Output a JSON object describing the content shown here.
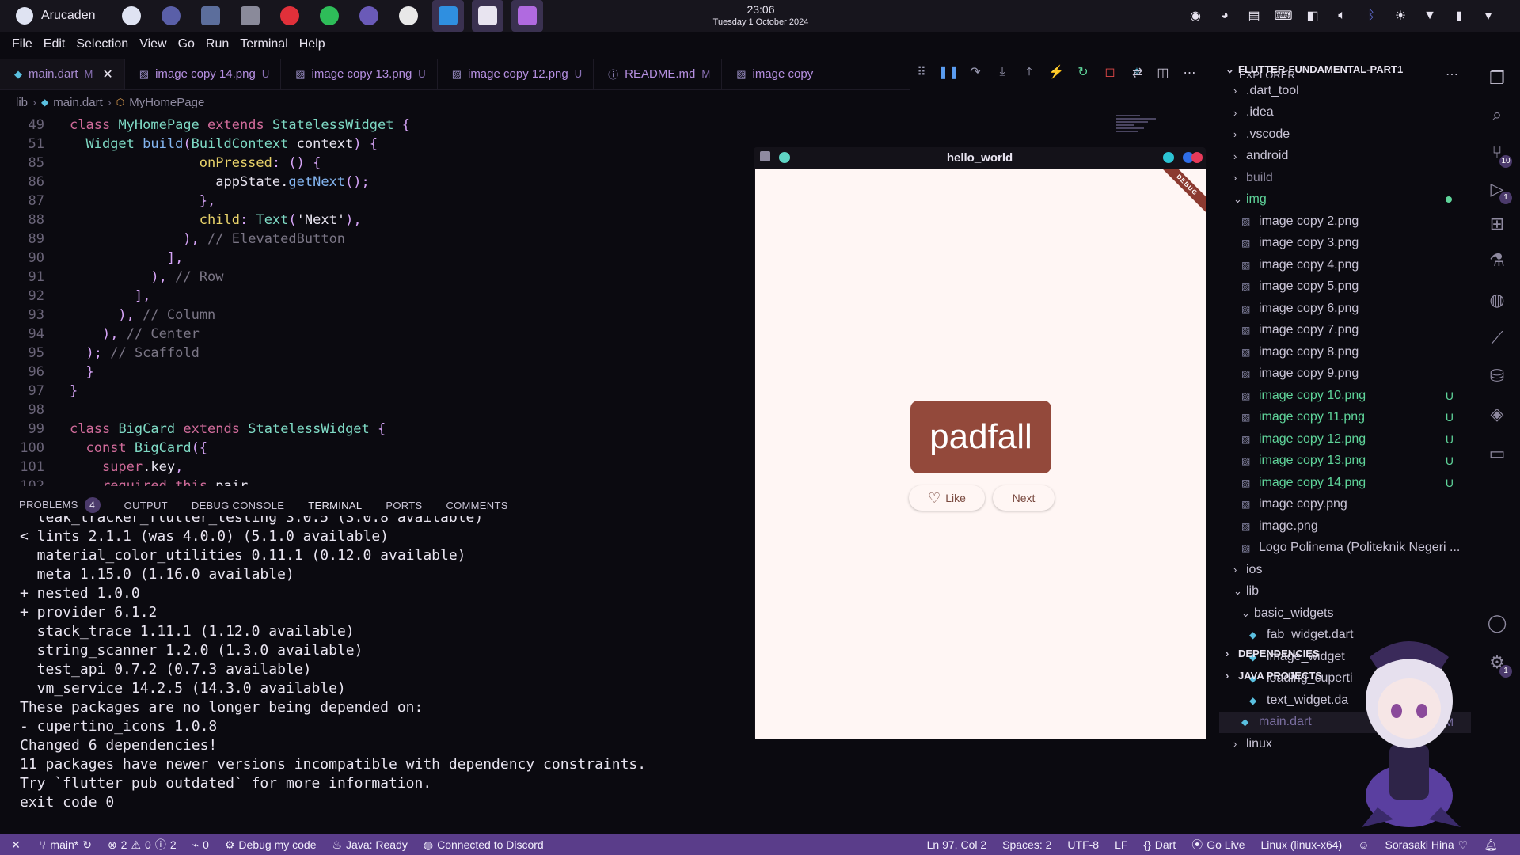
{
  "system": {
    "app_name": "Arucaden",
    "time": "23:06",
    "date": "Tuesday 1 October 2024",
    "dock": [
      {
        "icon": "browser-icon",
        "color": "#dfe3f2"
      },
      {
        "icon": "globe-icon",
        "color": "#5a5fa8"
      },
      {
        "icon": "folder-icon",
        "color": "#5c6e9c"
      },
      {
        "icon": "terminal-icon",
        "color": "#8a8a9a"
      },
      {
        "icon": "opera-icon",
        "color": "#e0303a"
      },
      {
        "icon": "spotify-icon",
        "color": "#2ebd59"
      },
      {
        "icon": "character-app-icon",
        "color": "#6a5ab8"
      },
      {
        "icon": "github-icon",
        "color": "#e8e8e8"
      },
      {
        "icon": "vscode-icon",
        "color": "#2f8fe0"
      },
      {
        "icon": "x-app-icon",
        "color": "#e8e4f0"
      },
      {
        "icon": "game-app-icon",
        "color": "#b06ae0"
      }
    ],
    "tray": [
      "discord-icon",
      "gamepad-icon",
      "clipboard-icon",
      "keyboard-icon",
      "app-icon",
      "volume-icon",
      "bluetooth-icon",
      "brightness-icon",
      "wifi-icon",
      "battery-icon",
      "chevron-down-icon"
    ]
  },
  "menu": [
    "File",
    "Edit",
    "Selection",
    "View",
    "Go",
    "Run",
    "Terminal",
    "Help"
  ],
  "tabs": [
    {
      "label": "main.dart",
      "badge": "M",
      "active": true
    },
    {
      "label": "image copy 14.png",
      "badge": "U"
    },
    {
      "label": "image copy 13.png",
      "badge": "U"
    },
    {
      "label": "image copy 12.png",
      "badge": "U"
    },
    {
      "label": "README.md",
      "badge": "M"
    },
    {
      "label": "image copy",
      "badge": ""
    }
  ],
  "breadcrumb": [
    "lib",
    "main.dart",
    "MyHomePage"
  ],
  "code": [
    {
      "n": "49",
      "t": "class MyHomePage extends StatelessWidget {"
    },
    {
      "n": "51",
      "t": "  Widget build(BuildContext context) {"
    },
    {
      "n": "85",
      "t": "                onPressed: () {"
    },
    {
      "n": "86",
      "t": "                  appState.getNext();"
    },
    {
      "n": "87",
      "t": "                },"
    },
    {
      "n": "88",
      "t": "                child: Text('Next'),"
    },
    {
      "n": "89",
      "t": "              ), // ElevatedButton"
    },
    {
      "n": "90",
      "t": "            ],"
    },
    {
      "n": "91",
      "t": "          ), // Row"
    },
    {
      "n": "92",
      "t": "        ],"
    },
    {
      "n": "93",
      "t": "      ), // Column"
    },
    {
      "n": "94",
      "t": "    ), // Center"
    },
    {
      "n": "95",
      "t": "  ); // Scaffold"
    },
    {
      "n": "96",
      "t": "  }"
    },
    {
      "n": "97",
      "t": "}"
    },
    {
      "n": "98",
      "t": ""
    },
    {
      "n": "99",
      "t": "class BigCard extends StatelessWidget {"
    },
    {
      "n": "100",
      "t": "  const BigCard({"
    },
    {
      "n": "101",
      "t": "    super.key,"
    },
    {
      "n": "102",
      "t": "    required this.pair,"
    }
  ],
  "panel": {
    "tabs": [
      "PROBLEMS",
      "OUTPUT",
      "DEBUG CONSOLE",
      "TERMINAL",
      "PORTS",
      "COMMENTS"
    ],
    "problems_count": "4",
    "terminal": [
      "  leak_tracker_flutter_testing 3.0.5 (3.0.8 available)",
      "< lints 2.1.1 (was 4.0.0) (5.1.0 available)",
      "  material_color_utilities 0.11.1 (0.12.0 available)",
      "  meta 1.15.0 (1.16.0 available)",
      "+ nested 1.0.0",
      "+ provider 6.1.2",
      "  stack_trace 1.11.1 (1.12.0 available)",
      "  string_scanner 1.2.0 (1.3.0 available)",
      "  test_api 0.7.2 (0.7.3 available)",
      "  vm_service 14.2.5 (14.3.0 available)",
      "These packages are no longer being depended on:",
      "- cupertino_icons 1.0.8",
      "Changed 6 dependencies!",
      "11 packages have newer versions incompatible with dependency constraints.",
      "Try `flutter pub outdated` for more information.",
      "exit code 0"
    ]
  },
  "flutter_window": {
    "title": "hello_world",
    "debug_banner": "DEBUG",
    "word": "padfall",
    "like_label": "Like",
    "next_label": "Next",
    "card_color": "#93493b",
    "background": "#fff6f4"
  },
  "explorer": {
    "title": "EXPLORER",
    "root": "FLUTTER-FUNDAMENTAL-PART1",
    "items": [
      {
        "label": ".dart_tool",
        "kind": "folder",
        "depth": 1,
        "open": false
      },
      {
        "label": ".idea",
        "kind": "folder",
        "depth": 1,
        "open": false
      },
      {
        "label": ".vscode",
        "kind": "folder",
        "depth": 1,
        "open": false
      },
      {
        "label": "android",
        "kind": "folder",
        "depth": 1,
        "open": false
      },
      {
        "label": "build",
        "kind": "folder",
        "depth": 1,
        "open": false,
        "dim": true
      },
      {
        "label": "img",
        "kind": "folder",
        "depth": 1,
        "open": true,
        "untracked": true
      },
      {
        "label": "image copy 2.png",
        "kind": "image",
        "depth": 2
      },
      {
        "label": "image copy 3.png",
        "kind": "image",
        "depth": 2
      },
      {
        "label": "image copy 4.png",
        "kind": "image",
        "depth": 2
      },
      {
        "label": "image copy 5.png",
        "kind": "image",
        "depth": 2
      },
      {
        "label": "image copy 6.png",
        "kind": "image",
        "depth": 2
      },
      {
        "label": "image copy 7.png",
        "kind": "image",
        "depth": 2
      },
      {
        "label": "image copy 8.png",
        "kind": "image",
        "depth": 2
      },
      {
        "label": "image copy 9.png",
        "kind": "image",
        "depth": 2
      },
      {
        "label": "image copy 10.png",
        "kind": "image",
        "depth": 2,
        "untracked": true,
        "badge": "U"
      },
      {
        "label": "image copy 11.png",
        "kind": "image",
        "depth": 2,
        "untracked": true,
        "badge": "U"
      },
      {
        "label": "image copy 12.png",
        "kind": "image",
        "depth": 2,
        "untracked": true,
        "badge": "U"
      },
      {
        "label": "image copy 13.png",
        "kind": "image",
        "depth": 2,
        "untracked": true,
        "badge": "U"
      },
      {
        "label": "image copy 14.png",
        "kind": "image",
        "depth": 2,
        "untracked": true,
        "badge": "U"
      },
      {
        "label": "image copy.png",
        "kind": "image",
        "depth": 2
      },
      {
        "label": "image.png",
        "kind": "image",
        "depth": 2
      },
      {
        "label": "Logo Polinema (Politeknik Negeri ...",
        "kind": "image",
        "depth": 2
      },
      {
        "label": "ios",
        "kind": "folder",
        "depth": 1,
        "open": false
      },
      {
        "label": "lib",
        "kind": "folder",
        "depth": 1,
        "open": true
      },
      {
        "label": "basic_widgets",
        "kind": "folder",
        "depth": 2,
        "open": true
      },
      {
        "label": "fab_widget.dart",
        "kind": "dart",
        "depth": 3
      },
      {
        "label": "image_widget",
        "kind": "dart",
        "depth": 3
      },
      {
        "label": "loading_cuperti",
        "kind": "dart",
        "depth": 3
      },
      {
        "label": "text_widget.da",
        "kind": "dart",
        "depth": 3
      },
      {
        "label": "main.dart",
        "kind": "dart",
        "depth": 2,
        "selected": true,
        "badge": "M"
      },
      {
        "label": "linux",
        "kind": "folder",
        "depth": 1,
        "open": false
      }
    ],
    "sections": [
      "DEPENDENCIES",
      "JAVA PROJECTS"
    ]
  },
  "activity": [
    {
      "icon": "files-icon"
    },
    {
      "icon": "search-icon"
    },
    {
      "icon": "source-control-icon",
      "badge": "10"
    },
    {
      "icon": "run-debug-icon",
      "badge": "1"
    },
    {
      "icon": "extensions-icon"
    },
    {
      "icon": "testing-icon"
    },
    {
      "icon": "github-icon"
    },
    {
      "icon": "flutter-icon"
    },
    {
      "icon": "database-icon"
    },
    {
      "icon": "layers-icon"
    },
    {
      "icon": "chat-icon"
    },
    {
      "icon": "account-icon"
    },
    {
      "icon": "settings-icon",
      "badge": "1"
    }
  ],
  "status": {
    "branch": "main*",
    "errors": "2",
    "warnings": "0",
    "infos": "2",
    "ports": "0",
    "debug": "Debug my code",
    "java": "Java: Ready",
    "discord": "Connected to Discord",
    "position": "Ln 97, Col 2",
    "spaces": "Spaces: 2",
    "encoding": "UTF-8",
    "eol": "LF",
    "language": "Dart",
    "golive": "Go Live",
    "device": "Linux (linux-x64)",
    "user": "Sorasaki Hina"
  }
}
